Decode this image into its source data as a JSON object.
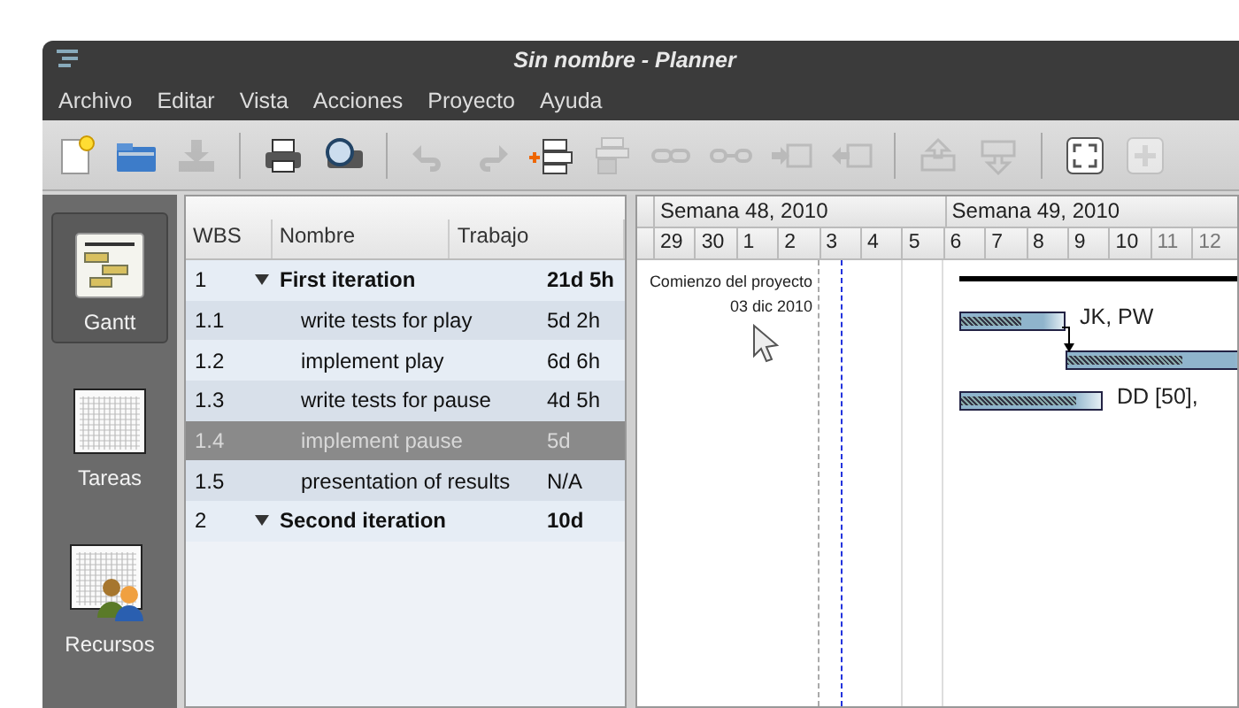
{
  "window": {
    "title": "Sin nombre - Planner"
  },
  "menu": [
    "Archivo",
    "Editar",
    "Vista",
    "Acciones",
    "Proyecto",
    "Ayuda"
  ],
  "toolbar": [
    {
      "kind": "new",
      "disabled": false
    },
    {
      "kind": "open",
      "disabled": false
    },
    {
      "kind": "save",
      "disabled": true
    },
    {
      "kind": "separator"
    },
    {
      "kind": "print",
      "disabled": false
    },
    {
      "kind": "preview",
      "disabled": false
    },
    {
      "kind": "separator"
    },
    {
      "kind": "undo",
      "disabled": true
    },
    {
      "kind": "redo",
      "disabled": true
    },
    {
      "kind": "insert",
      "disabled": false
    },
    {
      "kind": "remove",
      "disabled": true
    },
    {
      "kind": "link",
      "disabled": true
    },
    {
      "kind": "unlink",
      "disabled": true
    },
    {
      "kind": "indent",
      "disabled": true
    },
    {
      "kind": "unindent",
      "disabled": true
    },
    {
      "kind": "separator"
    },
    {
      "kind": "up",
      "disabled": true
    },
    {
      "kind": "down",
      "disabled": true
    },
    {
      "kind": "separator"
    },
    {
      "kind": "fit",
      "disabled": false
    },
    {
      "kind": "zoomin",
      "disabled": true
    }
  ],
  "views": [
    {
      "label": "Gantt",
      "kind": "gantt",
      "selected": true
    },
    {
      "label": "Tareas",
      "kind": "tasks",
      "selected": false
    },
    {
      "label": "Recursos",
      "kind": "resources",
      "selected": false
    }
  ],
  "task_table": {
    "columns": [
      "WBS",
      "Nombre",
      "Trabajo"
    ],
    "rows": [
      {
        "wbs": "1",
        "name": "First iteration",
        "work": "21d 5h",
        "kind": "summary",
        "expanded": true,
        "selected": false
      },
      {
        "wbs": "1.1",
        "name": "write tests for play",
        "work": "5d 2h",
        "kind": "task",
        "selected": false
      },
      {
        "wbs": "1.2",
        "name": "implement play",
        "work": "6d 6h",
        "kind": "task",
        "selected": false
      },
      {
        "wbs": "1.3",
        "name": "write tests for pause",
        "work": "4d 5h",
        "kind": "task",
        "selected": false
      },
      {
        "wbs": "1.4",
        "name": "implement pause",
        "work": "5d",
        "kind": "task",
        "selected": true
      },
      {
        "wbs": "1.5",
        "name": "presentation of results",
        "work": "N/A",
        "kind": "task",
        "selected": false
      },
      {
        "wbs": "2",
        "name": "Second iteration",
        "work": "10d",
        "kind": "summary",
        "expanded": true,
        "selected": false
      }
    ]
  },
  "gantt": {
    "weeks": [
      "Semana 48, 2010",
      "Semana 49, 2010"
    ],
    "days": [
      "29",
      "30",
      "1",
      "2",
      "3",
      "4",
      "5",
      "6",
      "7",
      "8",
      "9",
      "10",
      "11",
      "12"
    ],
    "project_start": {
      "label": "Comienzo del proyecto",
      "date": "03 dic 2010"
    },
    "bars": [
      {
        "kind": "summary"
      },
      {
        "kind": "task",
        "level": 0.58,
        "resources": "JK, PW"
      },
      {
        "kind": "task",
        "level": 0.55
      },
      {
        "kind": "task",
        "level": 0.82,
        "resources": "DD [50],"
      }
    ]
  }
}
